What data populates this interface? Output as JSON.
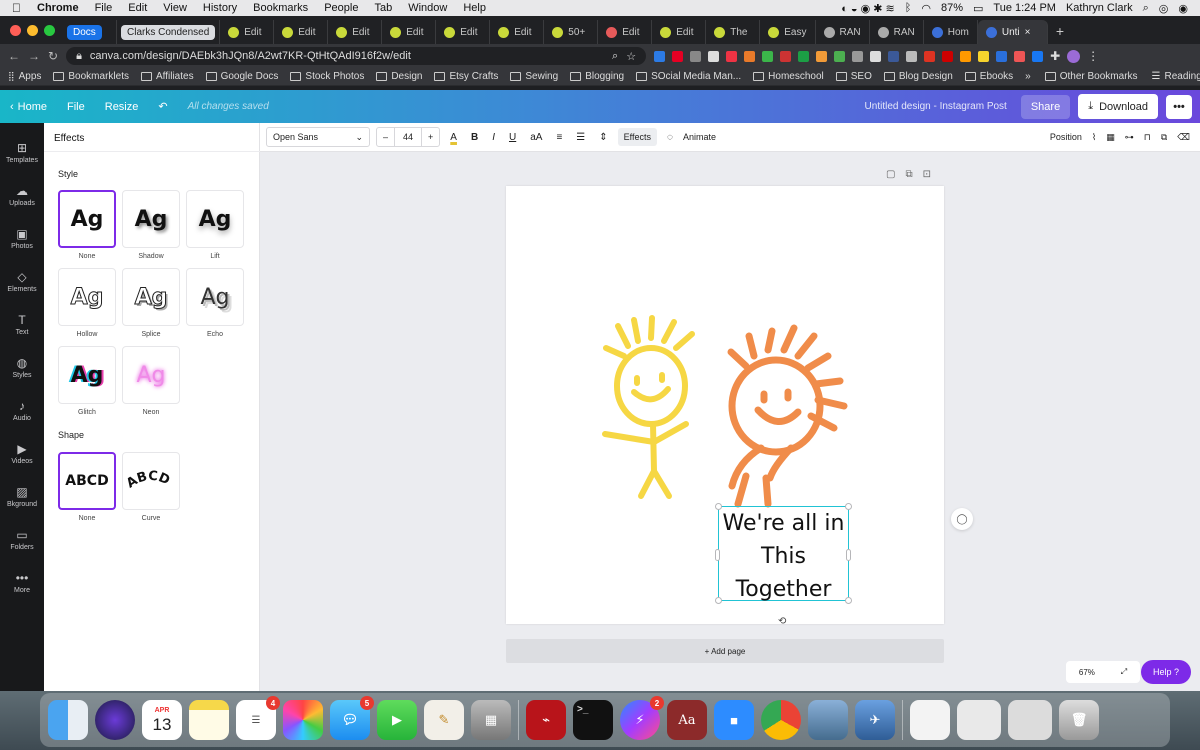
{
  "menubar": {
    "app": "Chrome",
    "items": [
      "File",
      "Edit",
      "View",
      "History",
      "Bookmarks",
      "People",
      "Tab",
      "Window",
      "Help"
    ],
    "battery": "87%",
    "clock": "Tue 1:24 PM",
    "user": "Kathryn Clark"
  },
  "tabs": {
    "pill_docs": "Docs",
    "pill_clarks": "Clarks Condensed",
    "items": [
      {
        "label": "Edit",
        "color": "#c9d93a"
      },
      {
        "label": "Edit",
        "color": "#c9d93a"
      },
      {
        "label": "Edit",
        "color": "#c9d93a"
      },
      {
        "label": "Edit",
        "color": "#c9d93a"
      },
      {
        "label": "Edit",
        "color": "#c9d93a"
      },
      {
        "label": "Edit",
        "color": "#c9d93a"
      },
      {
        "label": "50+",
        "color": "#c9d93a"
      },
      {
        "label": "Edit",
        "color": "#e65a5a"
      },
      {
        "label": "Edit",
        "color": "#c9d93a"
      },
      {
        "label": "The",
        "color": "#c9d93a"
      },
      {
        "label": "Easy",
        "color": "#c9d93a"
      },
      {
        "label": "RAN",
        "color": "#aaaaaa"
      },
      {
        "label": "RAN",
        "color": "#aaaaaa"
      },
      {
        "label": "Hom",
        "color": "#3b6fd8"
      }
    ],
    "active": "Unti"
  },
  "address": {
    "url": "canva.com/design/DAEbk3hJQn8/A2wt7KR-QtHtQAdI916f2w/edit"
  },
  "bookmarks": {
    "items": [
      "Apps",
      "Bookmarklets",
      "Affiliates",
      "Google Docs",
      "Stock Photos",
      "Design",
      "Etsy Crafts",
      "Sewing",
      "Blogging",
      "SOcial Media Man...",
      "Homeschool",
      "SEO",
      "Blog Design",
      "Ebooks"
    ],
    "more": "»",
    "other": "Other Bookmarks",
    "reading": "Reading List"
  },
  "canva_header": {
    "home": "Home",
    "file": "File",
    "resize": "Resize",
    "saved": "All changes saved",
    "title": "Untitled design - Instagram Post",
    "share": "Share",
    "download": "Download",
    "more": "•••"
  },
  "rail": [
    {
      "label": "Templates",
      "icon": "⊞"
    },
    {
      "label": "Uploads",
      "icon": "☁"
    },
    {
      "label": "Photos",
      "icon": "▣"
    },
    {
      "label": "Elements",
      "icon": "◇"
    },
    {
      "label": "Text",
      "icon": "T"
    },
    {
      "label": "Styles",
      "icon": "◍"
    },
    {
      "label": "Audio",
      "icon": "♪"
    },
    {
      "label": "Videos",
      "icon": "▶"
    },
    {
      "label": "Bkground",
      "icon": "▨"
    },
    {
      "label": "Folders",
      "icon": "▭"
    },
    {
      "label": "More",
      "icon": "•••"
    }
  ],
  "panel": {
    "title": "Effects",
    "style_heading": "Style",
    "styles": [
      {
        "label": "None",
        "sample": "Ag"
      },
      {
        "label": "Shadow",
        "sample": "Ag"
      },
      {
        "label": "Lift",
        "sample": "Ag"
      },
      {
        "label": "Hollow",
        "sample": "Ag"
      },
      {
        "label": "Splice",
        "sample": "Ag"
      },
      {
        "label": "Echo",
        "sample": "Ag"
      },
      {
        "label": "Glitch",
        "sample": "Ag"
      },
      {
        "label": "Neon",
        "sample": "Ag"
      }
    ],
    "shape_heading": "Shape",
    "shapes": [
      {
        "label": "None",
        "sample": "ABCD"
      },
      {
        "label": "Curve",
        "sample": "ABCD"
      }
    ]
  },
  "toolbar": {
    "font": "Open Sans",
    "minus": "–",
    "size": "44",
    "plus": "+",
    "bold": "B",
    "italic": "I",
    "underline": "U",
    "case": "aA",
    "effects": "Effects",
    "animate": "Animate",
    "position": "Position"
  },
  "canvas": {
    "text_line1": "We're all in",
    "text_line2": "This",
    "text_line3": "Together",
    "add_page": "+ Add page",
    "zoom": "67%",
    "help": "Help ?"
  },
  "dock": {
    "calendar_month": "APR",
    "calendar_day": "13",
    "badges": {
      "reminders": "4",
      "messages": "5",
      "messenger": "2"
    }
  }
}
